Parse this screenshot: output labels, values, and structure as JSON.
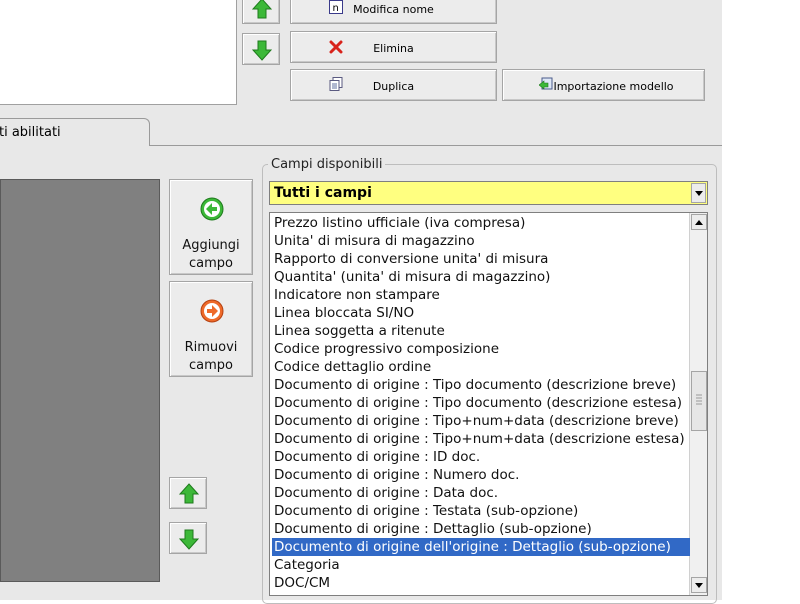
{
  "toolbar": {
    "rename_label": "Modifica nome",
    "delete_label": "Elimina",
    "duplicate_label": "Duplica",
    "import_label": "Importazione modello"
  },
  "tabs": {
    "enabled_fields_label": "ti abilitati"
  },
  "side_buttons": {
    "add_line1": "Aggiungi",
    "add_line2": "campo",
    "remove_line1": "Rimuovi",
    "remove_line2": "campo"
  },
  "available": {
    "group_title": "Campi disponibili",
    "filter_value": "Tutti i campi",
    "items": [
      "Prezzo listino ufficiale (iva compresa)",
      "Unita' di misura di magazzino",
      "Rapporto di conversione unita' di misura",
      "Quantita' (unita' di misura di magazzino)",
      "Indicatore non stampare",
      "Linea bloccata SI/NO",
      "Linea soggetta a ritenute",
      "Codice progressivo composizione",
      "Codice dettaglio ordine",
      "Documento di origine : Tipo documento (descrizione breve)",
      "Documento di origine : Tipo documento (descrizione estesa)",
      "Documento di origine : Tipo+num+data (descrizione breve)",
      "Documento di origine : Tipo+num+data (descrizione estesa)",
      "Documento di origine : ID doc.",
      "Documento di origine : Numero doc.",
      "Documento di origine : Data doc.",
      "Documento di origine : Testata (sub-opzione)",
      "Documento di origine : Dettaglio (sub-opzione)",
      "Documento di origine dell'origine : Dettaglio (sub-opzione)",
      "Categoria",
      "DOC/CM"
    ],
    "selected_index": 18
  },
  "colors": {
    "accent_green": "#3cb838",
    "selection": "#3169c6",
    "combo_bg": "#ffff80"
  }
}
